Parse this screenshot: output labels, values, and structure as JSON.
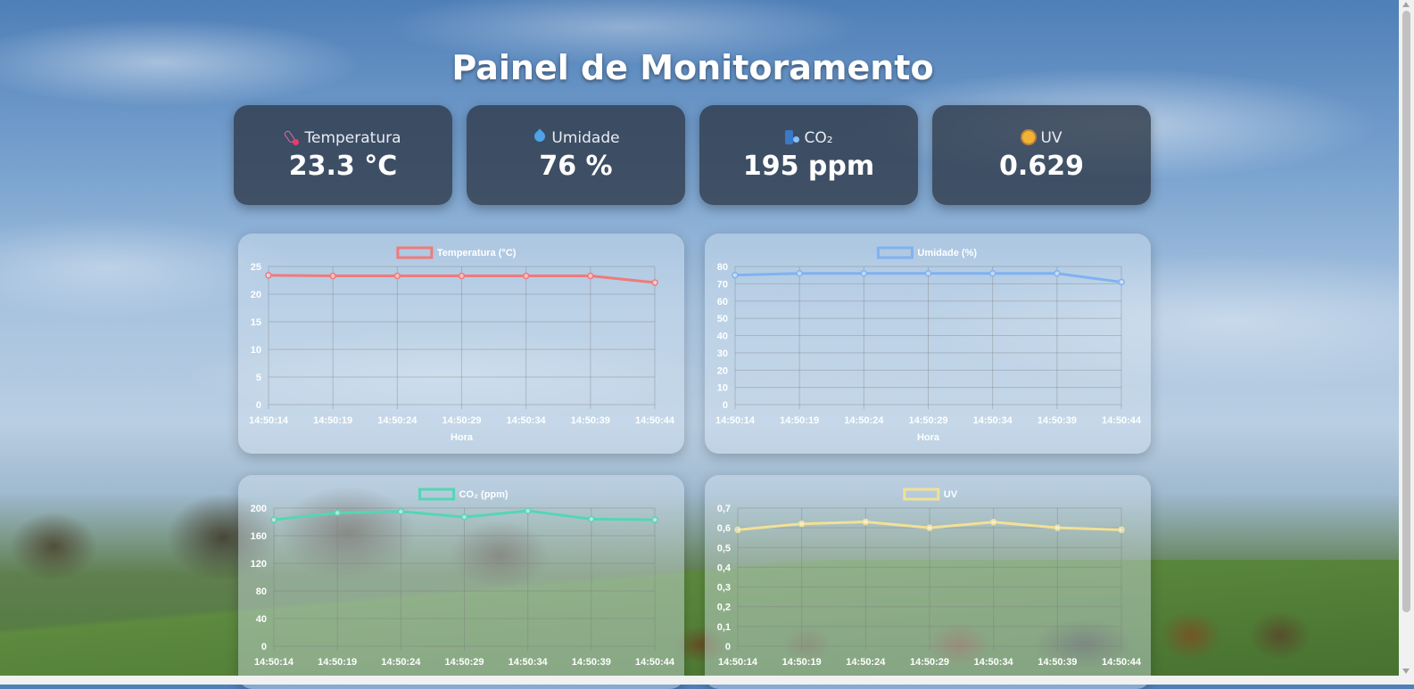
{
  "page": {
    "title": "Painel de Monitoramento"
  },
  "cards": [
    {
      "label": "Temperatura",
      "value": "23.3 °C",
      "icon": "thermometer-icon"
    },
    {
      "label": "Umidade",
      "value": "76 %",
      "icon": "droplet-icon"
    },
    {
      "label": "CO₂",
      "value": "195 ppm",
      "icon": "co2-icon"
    },
    {
      "label": "UV",
      "value": "0.629",
      "icon": "sun-icon"
    }
  ],
  "chart_data": [
    {
      "type": "line",
      "series": [
        {
          "name": "Temperatura (°C)",
          "color": "#f07a7a",
          "values": [
            23.4,
            23.3,
            23.3,
            23.3,
            23.3,
            23.3,
            22.1
          ]
        }
      ],
      "x": [
        "14:50:14",
        "14:50:19",
        "14:50:24",
        "14:50:29",
        "14:50:34",
        "14:50:39",
        "14:50:44"
      ],
      "xlabel": "Hora",
      "ylim": [
        0,
        25
      ],
      "yticks": [
        "0",
        "5",
        "10",
        "15",
        "20",
        "25"
      ],
      "legend": "top",
      "grid": true
    },
    {
      "type": "line",
      "series": [
        {
          "name": "Umidade (%)",
          "color": "#7fb2f2",
          "values": [
            75,
            76,
            76,
            76,
            76,
            76,
            71
          ]
        }
      ],
      "x": [
        "14:50:14",
        "14:50:19",
        "14:50:24",
        "14:50:29",
        "14:50:34",
        "14:50:39",
        "14:50:44"
      ],
      "xlabel": "Hora",
      "ylim": [
        0,
        80
      ],
      "yticks": [
        "0",
        "10",
        "20",
        "30",
        "40",
        "50",
        "60",
        "70",
        "80"
      ],
      "legend": "top",
      "grid": true
    },
    {
      "type": "line",
      "series": [
        {
          "name": "CO₂ (ppm)",
          "color": "#55d6b3",
          "values": [
            183,
            193,
            195,
            187,
            196,
            184,
            183
          ]
        }
      ],
      "x": [
        "14:50:14",
        "14:50:19",
        "14:50:24",
        "14:50:29",
        "14:50:34",
        "14:50:39",
        "14:50:44"
      ],
      "xlabel": "",
      "ylim": [
        0,
        200
      ],
      "yticks": [
        "0",
        "40",
        "80",
        "120",
        "160",
        "200"
      ],
      "legend": "top",
      "grid": true
    },
    {
      "type": "line",
      "series": [
        {
          "name": "UV",
          "color": "#f2e096",
          "values": [
            0.59,
            0.62,
            0.63,
            0.6,
            0.629,
            0.6,
            0.59
          ]
        }
      ],
      "x": [
        "14:50:14",
        "14:50:19",
        "14:50:24",
        "14:50:29",
        "14:50:34",
        "14:50:39",
        "14:50:44"
      ],
      "xlabel": "",
      "ylim": [
        0,
        0.7
      ],
      "yticks": [
        "0",
        "0,1",
        "0,2",
        "0,3",
        "0,4",
        "0,5",
        "0,6",
        "0,7"
      ],
      "legend": "top",
      "grid": true
    }
  ]
}
